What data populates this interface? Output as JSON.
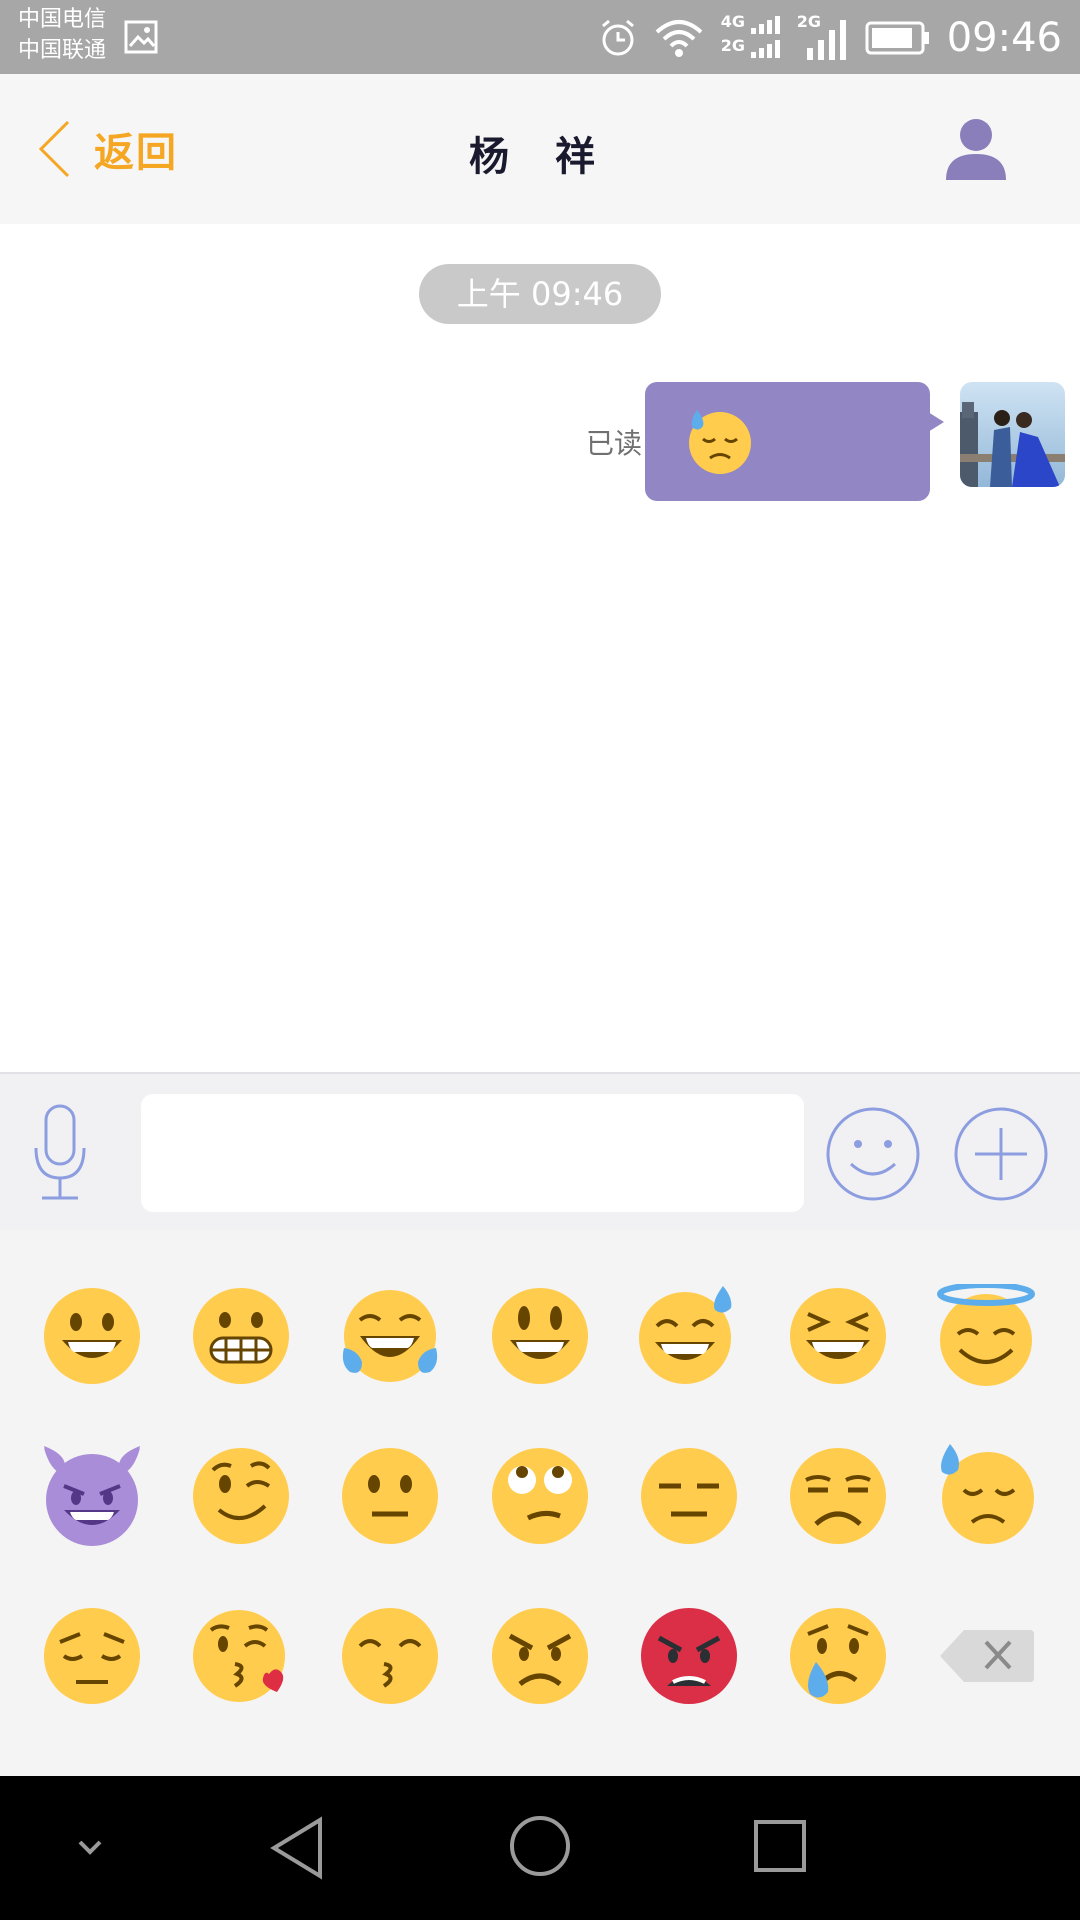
{
  "status_bar": {
    "carrier_1": "中国电信",
    "carrier_2": "中国联通",
    "network_1": "4G",
    "network_2": "2G",
    "network_3": "2G",
    "time": "09:46"
  },
  "header": {
    "back_label": "返回",
    "title": "杨 祥"
  },
  "chat": {
    "time_divider": "上午 09:46",
    "messages": [
      {
        "from": "me",
        "read_status": "已读",
        "content_emoji": "downcast-face-with-sweat"
      }
    ]
  },
  "input": {
    "text_value": "",
    "placeholder": ""
  },
  "emoji_panel": {
    "rows": [
      [
        "grinning",
        "grimacing",
        "tears-of-joy",
        "smiley",
        "sweat-smile",
        "laughing",
        "innocent"
      ],
      [
        "smiling-imp",
        "wink",
        "neutral",
        "eye-roll",
        "expressionless",
        "unamused",
        "downcast-sweat"
      ],
      [
        "pensive",
        "kissing-heart",
        "kissing-smiling-eyes",
        "angry",
        "rage",
        "cry",
        "delete"
      ]
    ]
  },
  "colors": {
    "accent_orange": "#f5a623",
    "bubble_purple": "#9386c4",
    "icon_blue": "#8c9ee0",
    "emoji_yellow": "#ffcc4d"
  }
}
